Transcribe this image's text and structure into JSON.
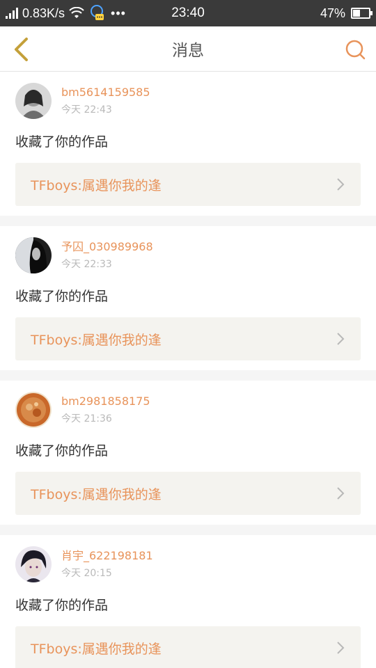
{
  "status_bar": {
    "network_speed": "0.83K/s",
    "time": "23:40",
    "battery": "47%",
    "battery_level": 0.47
  },
  "header": {
    "title": "消息",
    "back_icon": "chevron-left-icon",
    "search_icon": "search-icon"
  },
  "colors": {
    "accent": "#e8935a",
    "back_icon": "#c4a03a",
    "time_text": "#b9b9b9",
    "card_link_bg": "#f4f3ef"
  },
  "messages": [
    {
      "username": "bm5614159585",
      "time": "今天 22:43",
      "action": "收藏了你的作品",
      "work_title": "TFboys:属遇你我的逢"
    },
    {
      "username": "予囚_030989968",
      "time": "今天 22:33",
      "action": "收藏了你的作品",
      "work_title": "TFboys:属遇你我的逢"
    },
    {
      "username": "bm2981858175",
      "time": "今天 21:36",
      "action": "收藏了你的作品",
      "work_title": "TFboys:属遇你我的逢"
    },
    {
      "username": "肖宇_622198181",
      "time": "今天 20:15",
      "action": "收藏了你的作品",
      "work_title": "TFboys:属遇你我的逢"
    }
  ]
}
